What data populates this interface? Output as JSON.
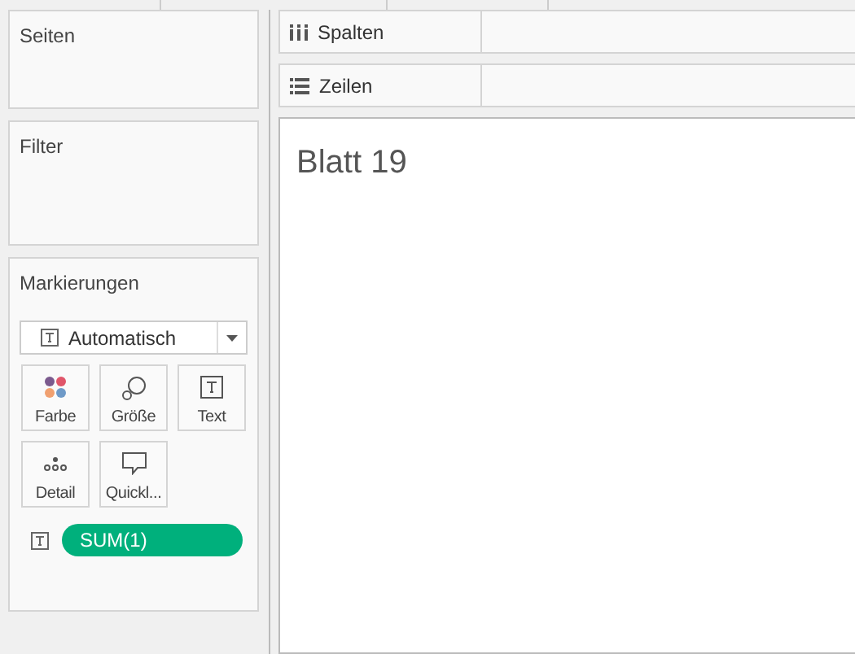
{
  "panels": [
    {
      "title": "Seiten"
    },
    {
      "title": "Filter"
    }
  ],
  "shelves": [
    {
      "kind": "columns",
      "label": "Spalten"
    },
    {
      "kind": "rows",
      "label": "Zeilen"
    }
  ],
  "marks": {
    "title": "Markierungen",
    "mark_type": "Automatisch",
    "cards": [
      {
        "kind": "color",
        "label": "Farbe"
      },
      {
        "kind": "size",
        "label": "Größe"
      },
      {
        "kind": "text",
        "label": "Text"
      },
      {
        "kind": "detail",
        "label": "Detail"
      },
      {
        "kind": "tooltip",
        "label": "Quickl..."
      }
    ],
    "pills": [
      {
        "kind": "text",
        "label": "SUM(1)"
      }
    ]
  },
  "sheet": {
    "title": "Blatt 19"
  }
}
